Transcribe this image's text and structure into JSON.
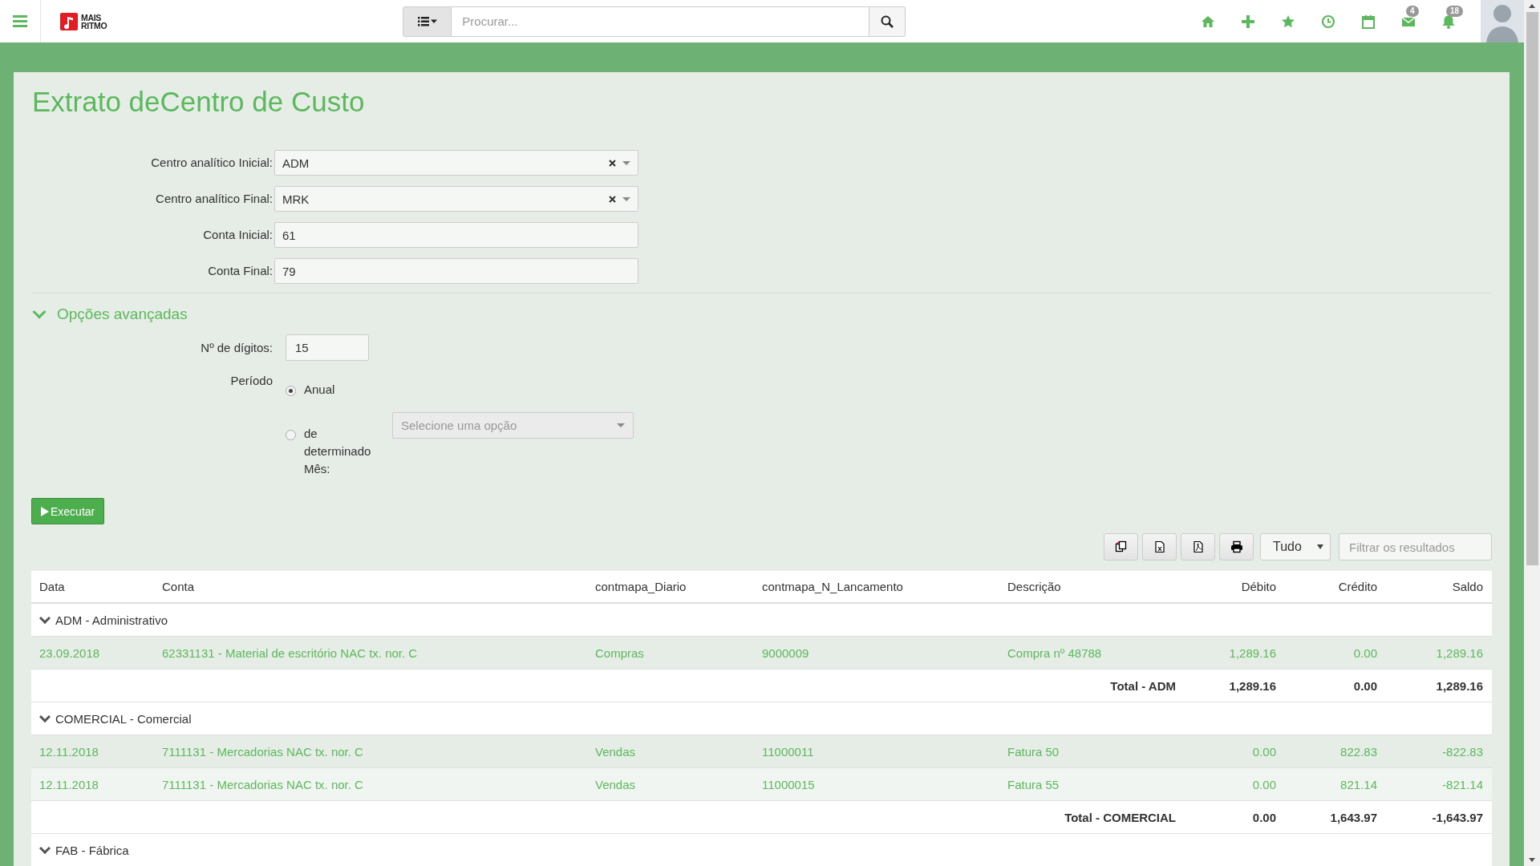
{
  "topbar": {
    "logo": {
      "line1": "MAIS",
      "line2": "RITMO"
    },
    "search": {
      "placeholder": "Procurar..."
    },
    "icons": [
      {
        "kind": "home"
      },
      {
        "kind": "plus"
      },
      {
        "kind": "star"
      },
      {
        "kind": "clock"
      },
      {
        "kind": "calendar"
      },
      {
        "kind": "mail",
        "badge": "4"
      },
      {
        "kind": "bell",
        "badge": "18"
      }
    ]
  },
  "page": {
    "title": "Extrato deCentro de Custo"
  },
  "form": [
    {
      "kind": "select",
      "label": "Centro analítico Inicial:",
      "value": "ADM"
    },
    {
      "kind": "select",
      "label": "Centro analítico Final:",
      "value": "MRK"
    },
    {
      "kind": "text",
      "label": "Conta Inicial:",
      "value": "61"
    },
    {
      "kind": "text",
      "label": "Conta Final:",
      "value": "79"
    }
  ],
  "advanced": {
    "title": "Opções avançadas",
    "expanded": true,
    "digits": {
      "label": "Nº de dígitos:",
      "value": "15"
    },
    "period": {
      "label": "Período",
      "options": [
        {
          "label": "Anual",
          "selected": true
        },
        {
          "label": "de determinado Mês:",
          "selected": false
        }
      ],
      "month_select": {
        "placeholder": "Selecione uma opção"
      }
    }
  },
  "run_button": "Executar",
  "toolbar": {
    "buttons": [
      {
        "kind": "copy"
      },
      {
        "kind": "excel"
      },
      {
        "kind": "pdf"
      },
      {
        "kind": "print"
      }
    ],
    "length_select": "Tudo",
    "filter": {
      "placeholder": "Filtrar os resultados"
    }
  },
  "table": {
    "columns": [
      "Data",
      "Conta",
      "contmapa_Diario",
      "contmapa_N_Lancamento",
      "Descrição",
      "Débito",
      "Crédito",
      "Saldo"
    ],
    "groups": [
      {
        "label": "ADM - Administrativo",
        "expanded": true,
        "rows": [
          [
            "23.09.2018",
            "62331131 - Material de escritório NAC tx. nor. C",
            "Compras",
            "9000009",
            "Compra nº 48788",
            "1,289.16",
            "0.00",
            "1,289.16"
          ]
        ],
        "total": {
          "label": "Total - ADM",
          "debit": "1,289.16",
          "credit": "0.00",
          "balance": "1,289.16"
        }
      },
      {
        "label": "COMERCIAL - Comercial",
        "expanded": true,
        "rows": [
          [
            "12.11.2018",
            "7111131 - Mercadorias NAC tx. nor. C",
            "Vendas",
            "11000011",
            "Fatura 50",
            "0.00",
            "822.83",
            "-822.83"
          ],
          [
            "12.11.2018",
            "7111131 - Mercadorias NAC tx. nor. C",
            "Vendas",
            "11000015",
            "Fatura 55",
            "0.00",
            "821.14",
            "-821.14"
          ]
        ],
        "total": {
          "label": "Total - COMERCIAL",
          "debit": "0.00",
          "credit": "1,643.97",
          "balance": "-1,643.97"
        }
      },
      {
        "label": "FAB - Fábrica",
        "expanded": true
      }
    ]
  }
}
